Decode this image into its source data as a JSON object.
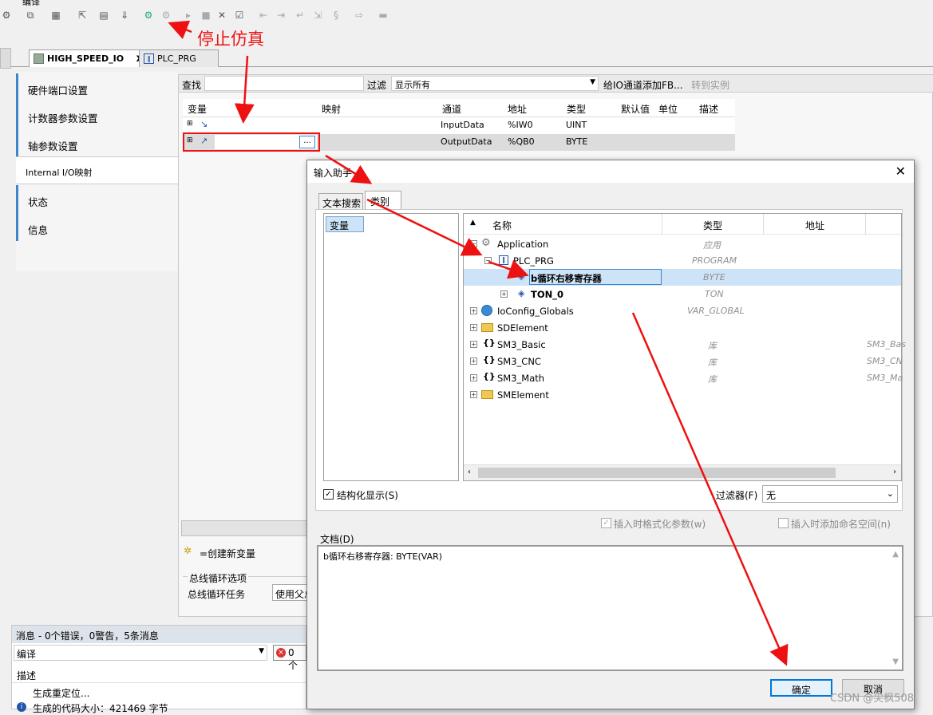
{
  "toolbar": {
    "partial_label": "编译",
    "left_text": "ĀŚ"
  },
  "annotation": {
    "stop_sim": "停止仿真"
  },
  "tabs": [
    {
      "label": "HIGH_SPEED_IO",
      "close": "x"
    },
    {
      "label": "PLC_PRG"
    }
  ],
  "sidebar": {
    "items": [
      "硬件端口设置",
      "计数器参数设置",
      "轴参数设置",
      "Internal I/O映射",
      "状态",
      "信息"
    ]
  },
  "filterbar": {
    "find_label": "查找",
    "filter_label": "过滤",
    "filter_value": "显示所有",
    "add_fb": "给IO通道添加FB...",
    "goto_instance": "转到实例"
  },
  "grid": {
    "headers": [
      "变量",
      "映射",
      "通道",
      "地址",
      "类型",
      "默认值",
      "单位",
      "描述"
    ],
    "rows": [
      {
        "channel": "InputData",
        "address": "%IW0",
        "type": "UINT"
      },
      {
        "channel": "OutputData",
        "address": "%QB0",
        "type": "BYTE",
        "browse": "..."
      }
    ]
  },
  "legend": {
    "create_var": "=创建新变量"
  },
  "bus": {
    "group": "总线循环选项",
    "task_label": "总线循环任务",
    "task_value": "使用父总"
  },
  "dialog": {
    "title": "输入助手",
    "tabs": [
      "文本搜索",
      "类别"
    ],
    "categories": [
      "变量"
    ],
    "columns": [
      "名称",
      "类型",
      "地址"
    ],
    "tree": [
      {
        "name": "Application",
        "type": "应用",
        "address": ""
      },
      {
        "name": "PLC_PRG",
        "type": "PROGRAM",
        "address": ""
      },
      {
        "name": "b循环右移寄存器",
        "type": "BYTE",
        "address": ""
      },
      {
        "name": "TON_0",
        "type": "TON",
        "address": ""
      },
      {
        "name": "IoConfig_Globals",
        "type": "VAR_GLOBAL",
        "address": ""
      },
      {
        "name": "SDElement",
        "type": "",
        "address": ""
      },
      {
        "name": "SM3_Basic",
        "type": "库",
        "address": "SM3_Bas"
      },
      {
        "name": "SM3_CNC",
        "type": "库",
        "address": "SM3_CN"
      },
      {
        "name": "SM3_Math",
        "type": "库",
        "address": "SM3_Ma"
      },
      {
        "name": "SMElement",
        "type": "",
        "address": ""
      }
    ],
    "structured_label": "结构化显示(S)",
    "filter_label": "过滤器(F)",
    "filter_value": "无",
    "insert_format": "插入时格式化参数(w)",
    "insert_namespace": "插入时添加命名空间(n)",
    "doc_label": "文档(D)",
    "doc_text": "b循环右移寄存器: BYTE(VAR)",
    "ok": "确定",
    "cancel": "取消"
  },
  "messages": {
    "header": "消息 - 0个错误，0警告，5条消息",
    "category": "编译",
    "errors": "0 个",
    "col_desc": "描述",
    "rows": [
      "生成重定位...",
      "生成的代码大小：421469 字节"
    ]
  },
  "watermark": "CSDN @尖枫508"
}
